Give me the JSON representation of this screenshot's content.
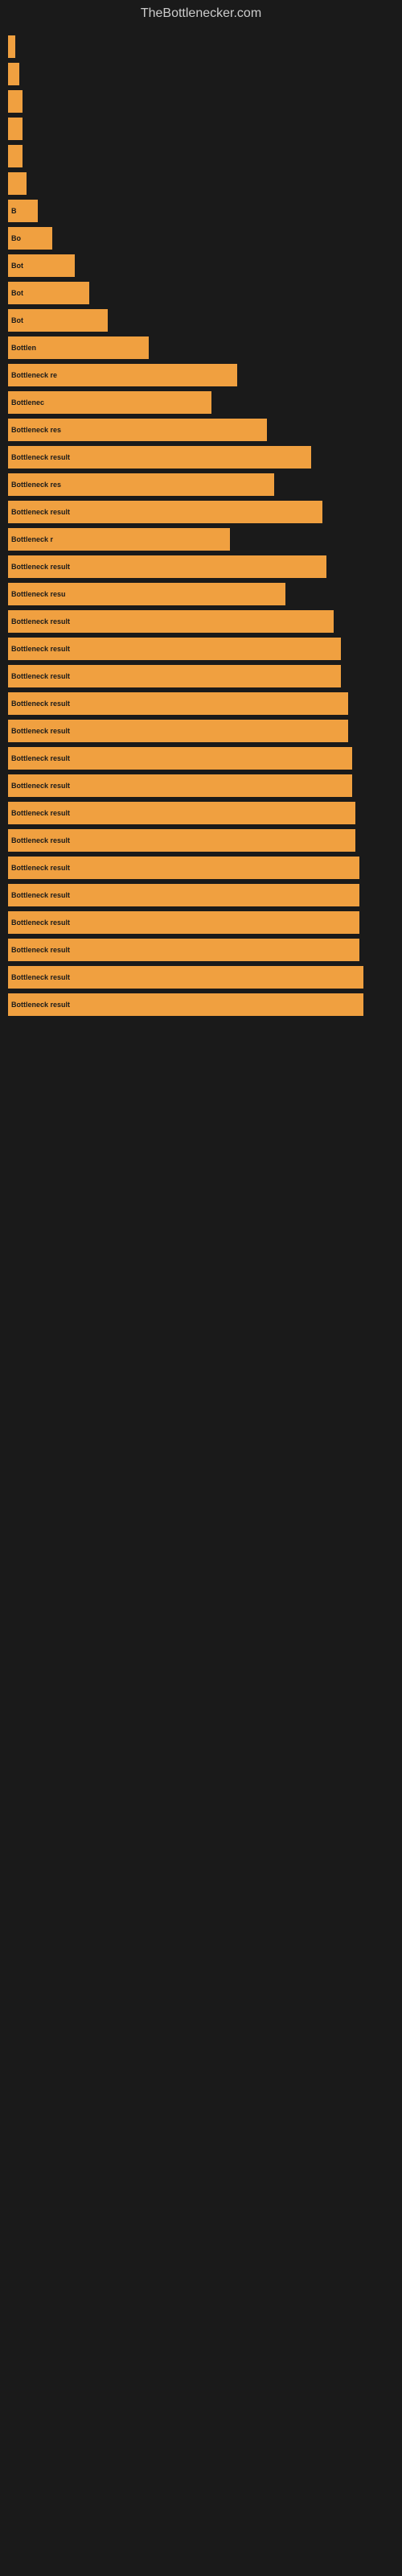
{
  "site": {
    "title": "TheBottlenecker.com"
  },
  "bars": [
    {
      "label": "",
      "width": 2
    },
    {
      "label": "",
      "width": 3
    },
    {
      "label": "",
      "width": 4
    },
    {
      "label": "",
      "width": 4
    },
    {
      "label": "",
      "width": 4
    },
    {
      "label": "",
      "width": 5
    },
    {
      "label": "B",
      "width": 8
    },
    {
      "label": "Bo",
      "width": 12
    },
    {
      "label": "Bot",
      "width": 18
    },
    {
      "label": "Bot",
      "width": 22
    },
    {
      "label": "Bot",
      "width": 27
    },
    {
      "label": "Bottlen",
      "width": 38
    },
    {
      "label": "Bottleneck re",
      "width": 62
    },
    {
      "label": "Bottlenec",
      "width": 55
    },
    {
      "label": "Bottleneck res",
      "width": 70
    },
    {
      "label": "Bottleneck result",
      "width": 82
    },
    {
      "label": "Bottleneck res",
      "width": 72
    },
    {
      "label": "Bottleneck result",
      "width": 85
    },
    {
      "label": "Bottleneck r",
      "width": 60
    },
    {
      "label": "Bottleneck result",
      "width": 86
    },
    {
      "label": "Bottleneck resu",
      "width": 75
    },
    {
      "label": "Bottleneck result",
      "width": 88
    },
    {
      "label": "Bottleneck result",
      "width": 90
    },
    {
      "label": "Bottleneck result",
      "width": 90
    },
    {
      "label": "Bottleneck result",
      "width": 92
    },
    {
      "label": "Bottleneck result",
      "width": 92
    },
    {
      "label": "Bottleneck result",
      "width": 93
    },
    {
      "label": "Bottleneck result",
      "width": 93
    },
    {
      "label": "Bottleneck result",
      "width": 94
    },
    {
      "label": "Bottleneck result",
      "width": 94
    },
    {
      "label": "Bottleneck result",
      "width": 95
    },
    {
      "label": "Bottleneck result",
      "width": 95
    },
    {
      "label": "Bottleneck result",
      "width": 95
    },
    {
      "label": "Bottleneck result",
      "width": 95
    },
    {
      "label": "Bottleneck result",
      "width": 96
    },
    {
      "label": "Bottleneck result",
      "width": 96
    }
  ]
}
